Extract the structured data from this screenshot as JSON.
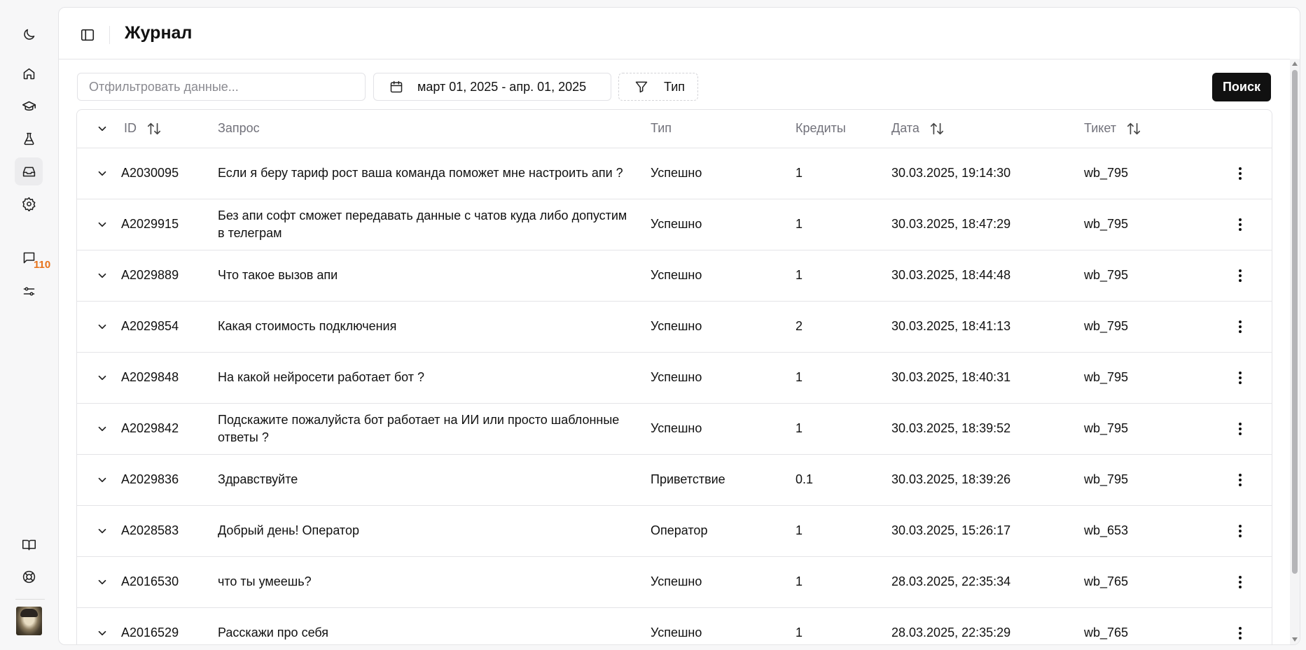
{
  "sidebar": {
    "items": [
      {
        "name": "theme-toggle",
        "icon": "moon-icon"
      },
      {
        "name": "home",
        "icon": "home-icon"
      },
      {
        "name": "learning",
        "icon": "graduation-cap-icon"
      },
      {
        "name": "lab",
        "icon": "flask-icon"
      },
      {
        "name": "journal",
        "icon": "inbox-icon",
        "active": true
      },
      {
        "name": "settings",
        "icon": "gear-icon"
      },
      {
        "name": "chats",
        "icon": "message-square-icon"
      },
      {
        "name": "filters",
        "icon": "sliders-icon"
      },
      {
        "name": "docs",
        "icon": "book-icon"
      },
      {
        "name": "support",
        "icon": "lifebuoy-icon"
      }
    ],
    "chat_badge": "110",
    "badge_color": "#e8731b"
  },
  "header": {
    "title": "Журнал"
  },
  "toolbar": {
    "filter_placeholder": "Отфильтровать данные...",
    "filter_value": "",
    "date_range": "март 01, 2025 - апр. 01, 2025",
    "type_label": "Тип",
    "search_label": "Поиск"
  },
  "table": {
    "columns": {
      "id": "ID",
      "request": "Запрос",
      "type": "Тип",
      "credits": "Кредиты",
      "date": "Дата",
      "ticket": "Тикет"
    },
    "rows": [
      {
        "id": "A2030095",
        "request": "Если я беру тариф рост ваша команда поможет мне настроить апи ?",
        "type": "Успешно",
        "credits": "1",
        "date": "30.03.2025, 19:14:30",
        "ticket": "wb_795"
      },
      {
        "id": "A2029915",
        "request": "Без апи софт сможет передавать данные с чатов куда либо допустим в телеграм",
        "type": "Успешно",
        "credits": "1",
        "date": "30.03.2025, 18:47:29",
        "ticket": "wb_795"
      },
      {
        "id": "A2029889",
        "request": "Что такое вызов апи",
        "type": "Успешно",
        "credits": "1",
        "date": "30.03.2025, 18:44:48",
        "ticket": "wb_795"
      },
      {
        "id": "A2029854",
        "request": "Какая стоимость подключения",
        "type": "Успешно",
        "credits": "2",
        "date": "30.03.2025, 18:41:13",
        "ticket": "wb_795"
      },
      {
        "id": "A2029848",
        "request": "На какой нейросети работает бот ?",
        "type": "Успешно",
        "credits": "1",
        "date": "30.03.2025, 18:40:31",
        "ticket": "wb_795"
      },
      {
        "id": "A2029842",
        "request": "Подскажите пожалуйста бот работает на ИИ или просто шаблонные ответы ?",
        "type": "Успешно",
        "credits": "1",
        "date": "30.03.2025, 18:39:52",
        "ticket": "wb_795"
      },
      {
        "id": "A2029836",
        "request": "Здравствуйте",
        "type": "Приветствие",
        "credits": "0.1",
        "date": "30.03.2025, 18:39:26",
        "ticket": "wb_795"
      },
      {
        "id": "A2028583",
        "request": "Добрый день! Оператор",
        "type": "Оператор",
        "credits": "1",
        "date": "30.03.2025, 15:26:17",
        "ticket": "wb_653"
      },
      {
        "id": "A2016530",
        "request": "что ты умеешь?",
        "type": "Успешно",
        "credits": "1",
        "date": "28.03.2025, 22:35:34",
        "ticket": "wb_765"
      },
      {
        "id": "A2016529",
        "request": "Расскажи про себя",
        "type": "Успешно",
        "credits": "1",
        "date": "28.03.2025, 22:35:29",
        "ticket": "wb_765"
      }
    ]
  }
}
